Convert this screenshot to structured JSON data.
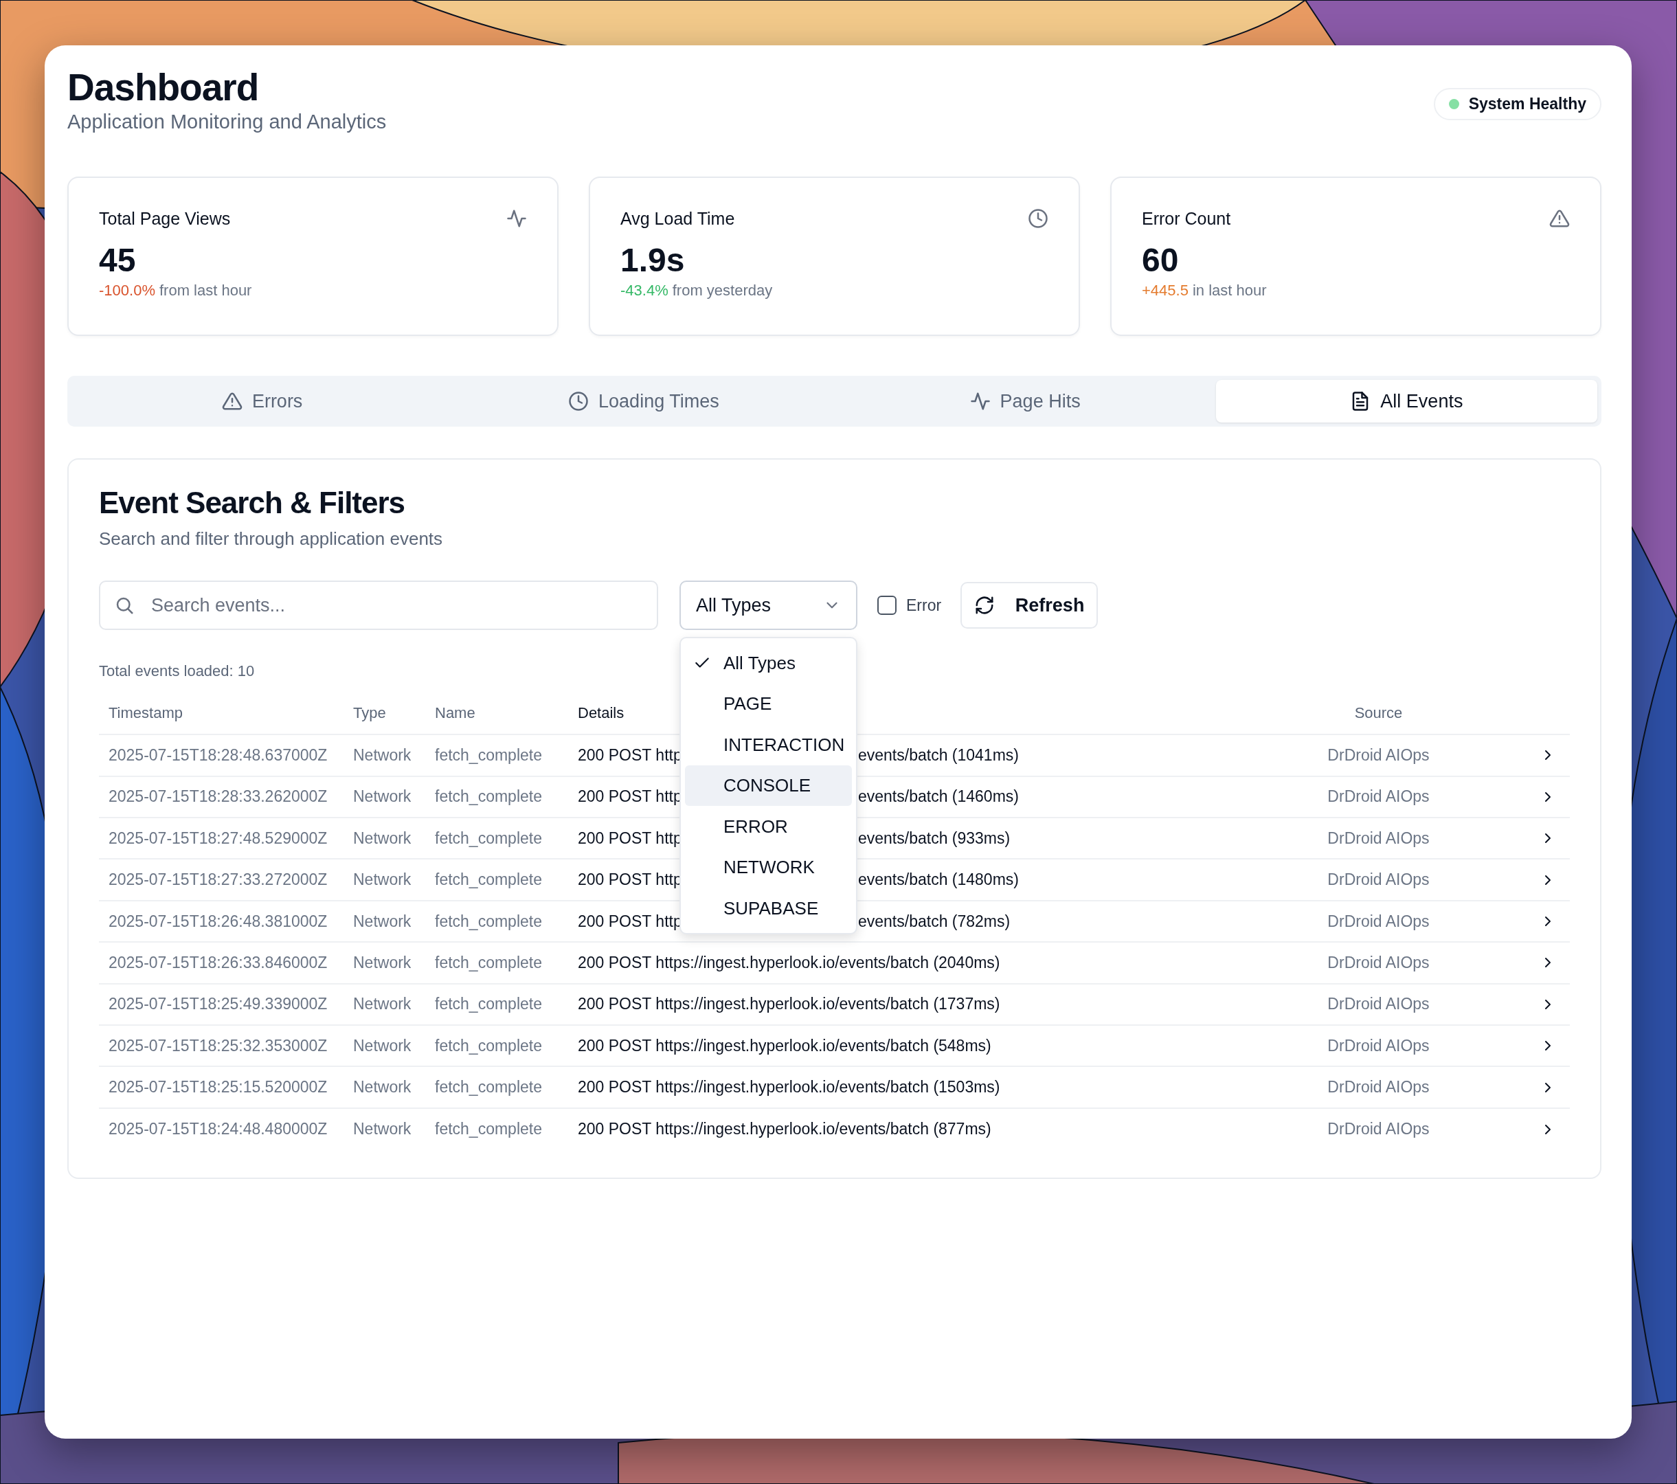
{
  "header": {
    "title": "Dashboard",
    "subtitle": "Application Monitoring and Analytics",
    "status": {
      "label": "System Healthy",
      "color": "#86e0a4"
    }
  },
  "stats": [
    {
      "title": "Total Page Views",
      "kind": "activity",
      "value": "45",
      "change": "-100.0%",
      "color": "#d9532c",
      "suffix": "from last hour"
    },
    {
      "title": "Avg Load Time",
      "kind": "clock",
      "value": "1.9s",
      "change": "-43.4%",
      "color": "#34b866",
      "suffix": "from yesterday"
    },
    {
      "title": "Error Count",
      "kind": "alert",
      "value": "60",
      "change": "+445.5",
      "color": "#e47b2e",
      "suffix": "in last hour"
    }
  ],
  "tabs": [
    {
      "label": "Errors",
      "kind": "alert",
      "selected": false
    },
    {
      "label": "Loading Times",
      "kind": "clock",
      "selected": false
    },
    {
      "label": "Page Hits",
      "kind": "activity",
      "selected": false
    },
    {
      "label": "All Events",
      "kind": "file",
      "selected": true
    }
  ],
  "events": {
    "title": "Event Search & Filters",
    "subtitle": "Search and filter through application events",
    "search": {
      "placeholder": "Search events..."
    },
    "type_filter": {
      "value": "All Types",
      "expanded": true,
      "options": [
        {
          "label": "All Types",
          "selected": true,
          "hovered": false
        },
        {
          "label": "PAGE",
          "selected": false,
          "hovered": false
        },
        {
          "label": "INTERACTION",
          "selected": false,
          "hovered": false
        },
        {
          "label": "CONSOLE",
          "selected": false,
          "hovered": true
        },
        {
          "label": "ERROR",
          "selected": false,
          "hovered": false
        },
        {
          "label": "NETWORK",
          "selected": false,
          "hovered": false
        },
        {
          "label": "SUPABASE",
          "selected": false,
          "hovered": false
        }
      ]
    },
    "error_filter": {
      "label": "Error",
      "checked": false
    },
    "refresh": "Refresh",
    "total": "Total events loaded: 10",
    "table": {
      "columns": [
        "Timestamp",
        "Type",
        "Name",
        "Details",
        "Source"
      ],
      "rows": [
        {
          "timestamp": "2025-07-15T18:28:48.637000Z",
          "type": "Network",
          "name": "fetch_complete",
          "details": [
            "200 POST http",
            "events/batch (1041ms)"
          ],
          "source": "DrDroid AIOps"
        },
        {
          "timestamp": "2025-07-15T18:28:33.262000Z",
          "type": "Network",
          "name": "fetch_complete",
          "details": [
            "200 POST http",
            "events/batch (1460ms)"
          ],
          "source": "DrDroid AIOps"
        },
        {
          "timestamp": "2025-07-15T18:27:48.529000Z",
          "type": "Network",
          "name": "fetch_complete",
          "details": [
            "200 POST http",
            "events/batch (933ms)"
          ],
          "source": "DrDroid AIOps"
        },
        {
          "timestamp": "2025-07-15T18:27:33.272000Z",
          "type": "Network",
          "name": "fetch_complete",
          "details": [
            "200 POST http",
            "events/batch (1480ms)"
          ],
          "source": "DrDroid AIOps"
        },
        {
          "timestamp": "2025-07-15T18:26:48.381000Z",
          "type": "Network",
          "name": "fetch_complete",
          "details": [
            "200 POST http",
            "events/batch (782ms)"
          ],
          "source": "DrDroid AIOps"
        },
        {
          "timestamp": "2025-07-15T18:26:33.846000Z",
          "type": "Network",
          "name": "fetch_complete",
          "details": [
            "200 POST https://ingest.hyperlook.io/events/batch (2040ms)"
          ],
          "source": "DrDroid AIOps"
        },
        {
          "timestamp": "2025-07-15T18:25:49.339000Z",
          "type": "Network",
          "name": "fetch_complete",
          "details": [
            "200 POST https://ingest.hyperlook.io/events/batch (1737ms)"
          ],
          "source": "DrDroid AIOps"
        },
        {
          "timestamp": "2025-07-15T18:25:32.353000Z",
          "type": "Network",
          "name": "fetch_complete",
          "details": [
            "200 POST https://ingest.hyperlook.io/events/batch (548ms)"
          ],
          "source": "DrDroid AIOps"
        },
        {
          "timestamp": "2025-07-15T18:25:15.520000Z",
          "type": "Network",
          "name": "fetch_complete",
          "details": [
            "200 POST https://ingest.hyperlook.io/events/batch (1503ms)"
          ],
          "source": "DrDroid AIOps"
        },
        {
          "timestamp": "2025-07-15T18:24:48.480000Z",
          "type": "Network",
          "name": "fetch_complete",
          "details": [
            "200 POST https://ingest.hyperlook.io/events/batch (877ms)"
          ],
          "source": "DrDroid AIOps"
        }
      ]
    }
  }
}
